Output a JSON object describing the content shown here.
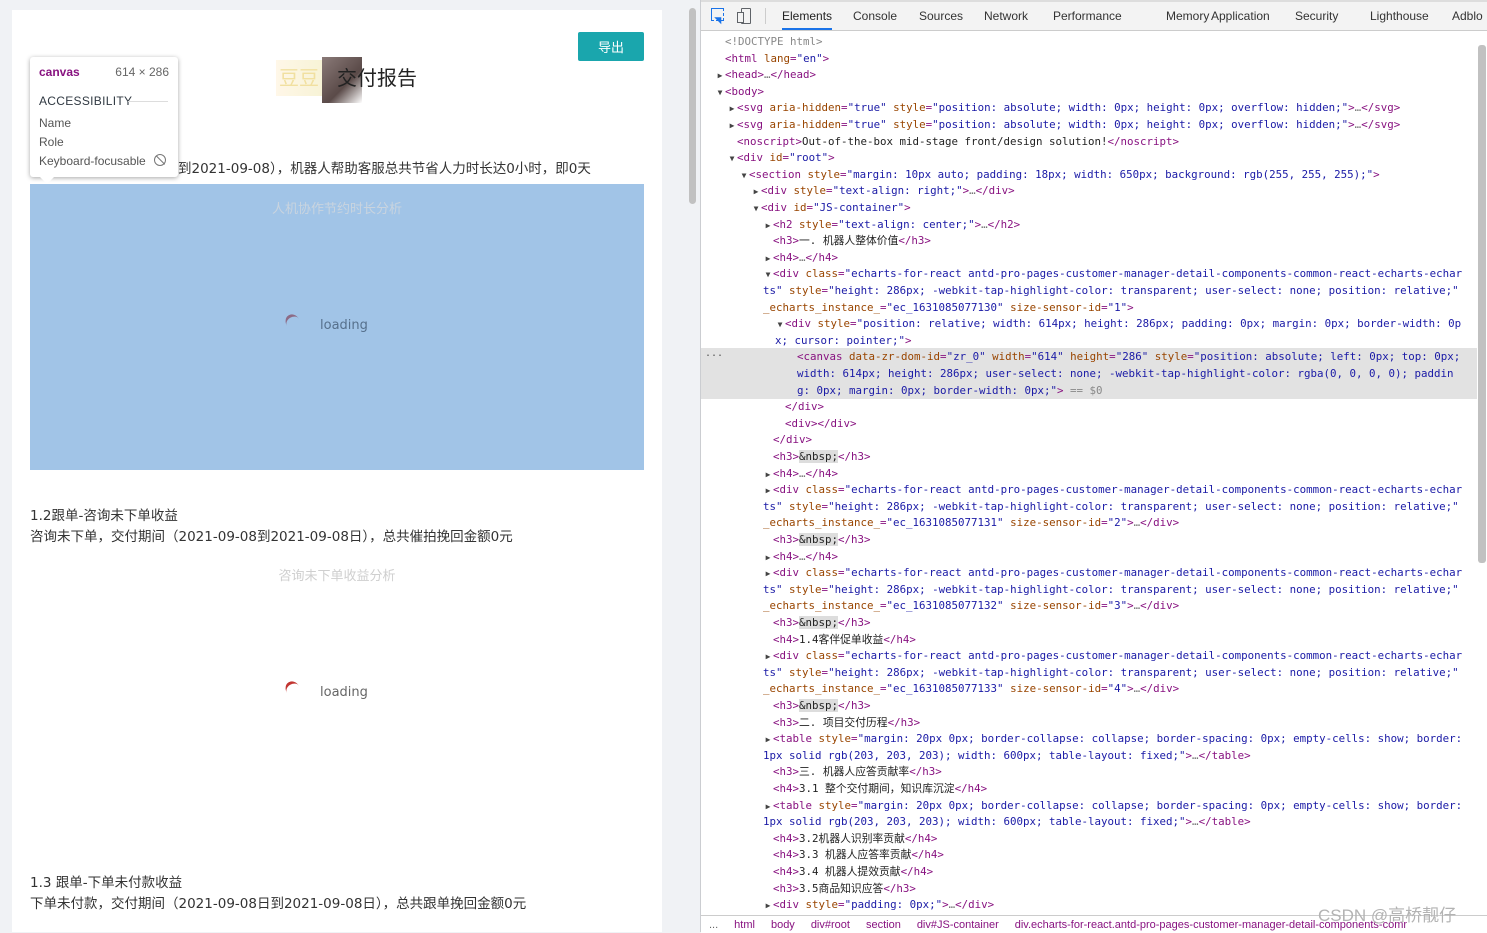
{
  "report": {
    "export_label": "导出",
    "title": "交付报告",
    "logo_text": "豆豆",
    "intro": "到2021-09-08），机器人帮助客服总共节省人力时长达0小时，即0天",
    "chart1": {
      "title": "人机协作节约时长分析",
      "loading": "loading"
    },
    "sec2_head": "1.2跟单-咨询未下单收益",
    "sec2_desc": "咨询未下单，交付期间（2021-09-08到2021-09-08日），总共催拍挽回金额0元",
    "chart2": {
      "title": "咨询未下单收益分析",
      "loading": "loading"
    },
    "sec3_head": "1.3 跟单-下单未付款收益",
    "sec3_desc": "下单未付款，交付期间（2021-09-08日到2021-09-08日），总共跟单挽回金额0元"
  },
  "tooltip": {
    "tag": "canvas",
    "size": "614 × 286",
    "accessibility": "ACCESSIBILITY",
    "name": "Name",
    "role": "Role",
    "focusable": "Keyboard-focusable"
  },
  "devtools": {
    "tabs": [
      "Elements",
      "Console",
      "Sources",
      "Network",
      "Performance",
      "Memory",
      "Application",
      "Security",
      "Lighthouse",
      "Adblo"
    ],
    "active_tab": "Elements",
    "breadcrumbs": [
      "...",
      "html",
      "body",
      "div#root",
      "section",
      "div#JS-container",
      "div.echarts-for-react.antd-pro-pages-customer-manager-detail-components-comr"
    ],
    "sel_marker": "...",
    "lines": [
      {
        "i": 0,
        "t": "",
        "h": "<span class=\"dim\">&lt;!DOCTYPE html&gt;</span>"
      },
      {
        "i": 0,
        "t": "",
        "h": "<span class=\"tn\">&lt;html</span> <span class=\"an\">lang</span><span class=\"tn\">=</span><span class=\"av\">\"en\"</span><span class=\"tn\">&gt;</span>"
      },
      {
        "i": 0,
        "t": "▶",
        "h": "<span class=\"tn\">&lt;head&gt;</span><span class=\"ell\">…</span><span class=\"tn\">&lt;/head&gt;</span>"
      },
      {
        "i": 0,
        "t": "▼",
        "h": "<span class=\"tn\">&lt;body&gt;</span>"
      },
      {
        "i": 1,
        "t": "▶",
        "h": "<span class=\"tn\">&lt;svg</span> <span class=\"an\">aria-hidden</span><span class=\"tn\">=</span><span class=\"av\">\"true\"</span> <span class=\"an\">style</span><span class=\"tn\">=</span><span class=\"av\">\"position: absolute; width: 0px; height: 0px; overflow: hidden;\"</span><span class=\"tn\">&gt;</span><span class=\"ell\">…</span><span class=\"tn\">&lt;/svg&gt;</span>"
      },
      {
        "i": 1,
        "t": "▶",
        "h": "<span class=\"tn\">&lt;svg</span> <span class=\"an\">aria-hidden</span><span class=\"tn\">=</span><span class=\"av\">\"true\"</span> <span class=\"an\">style</span><span class=\"tn\">=</span><span class=\"av\">\"position: absolute; width: 0px; height: 0px; overflow: hidden;\"</span><span class=\"tn\">&gt;</span><span class=\"ell\">…</span><span class=\"tn\">&lt;/svg&gt;</span>"
      },
      {
        "i": 1,
        "t": "",
        "h": "<span class=\"tn\">&lt;noscript&gt;</span><span class=\"tx\">Out-of-the-box mid-stage front/design solution!</span><span class=\"tn\">&lt;/noscript&gt;</span>"
      },
      {
        "i": 1,
        "t": "▼",
        "h": "<span class=\"tn\">&lt;div</span> <span class=\"an\">id</span><span class=\"tn\">=</span><span class=\"av\">\"root\"</span><span class=\"tn\">&gt;</span>"
      },
      {
        "i": 2,
        "t": "▼",
        "h": "<span class=\"tn\">&lt;section</span> <span class=\"an\">style</span><span class=\"tn\">=</span><span class=\"av\">\"margin: 10px auto; padding: 18px; width: 650px; background: rgb(255, 255, 255);\"</span><span class=\"tn\">&gt;</span>"
      },
      {
        "i": 3,
        "t": "▶",
        "h": "<span class=\"tn\">&lt;div</span> <span class=\"an\">style</span><span class=\"tn\">=</span><span class=\"av\">\"text-align: right;\"</span><span class=\"tn\">&gt;</span><span class=\"ell\">…</span><span class=\"tn\">&lt;/div&gt;</span>"
      },
      {
        "i": 3,
        "t": "▼",
        "h": "<span class=\"tn\">&lt;div</span> <span class=\"an\">id</span><span class=\"tn\">=</span><span class=\"av\">\"JS-container\"</span><span class=\"tn\">&gt;</span>"
      },
      {
        "i": 4,
        "t": "▶",
        "h": "<span class=\"tn\">&lt;h2</span> <span class=\"an\">style</span><span class=\"tn\">=</span><span class=\"av\">\"text-align: center;\"</span><span class=\"tn\">&gt;</span><span class=\"ell\">…</span><span class=\"tn\">&lt;/h2&gt;</span>"
      },
      {
        "i": 4,
        "t": "",
        "h": "<span class=\"tn\">&lt;h3&gt;</span><span class=\"tx\">一. 机器人整体价值</span><span class=\"tn\">&lt;/h3&gt;</span>"
      },
      {
        "i": 4,
        "t": "▶",
        "h": "<span class=\"tn\">&lt;h4&gt;</span><span class=\"ell\">…</span><span class=\"tn\">&lt;/h4&gt;</span>"
      },
      {
        "i": 4,
        "t": "▼",
        "h": "<span class=\"tn\">&lt;div</span> <span class=\"an\">class</span><span class=\"tn\">=</span><span class=\"av\">\"echarts-for-react antd-pro-pages-customer-manager-detail-components-common-react-echarts-echar</span>"
      },
      {
        "i": 4,
        "t": "",
        "x": -10,
        "h": "<span class=\"av\">ts\"</span> <span class=\"an\">style</span><span class=\"tn\">=</span><span class=\"av\">\"height: 286px; -webkit-tap-highlight-color: transparent; user-select: none; position: relative;\"</span>"
      },
      {
        "i": 4,
        "t": "",
        "x": -10,
        "h": "<span class=\"an\">_echarts_instance_</span><span class=\"tn\">=</span><span class=\"av\">\"ec_1631085077130\"</span> <span class=\"an\">size-sensor-id</span><span class=\"tn\">=</span><span class=\"av\">\"1\"</span><span class=\"tn\">&gt;</span>"
      },
      {
        "i": 5,
        "t": "▼",
        "h": "<span class=\"tn\">&lt;div</span> <span class=\"an\">style</span><span class=\"tn\">=</span><span class=\"av\">\"position: relative; width: 614px; height: 286px; padding: 0px; margin: 0px; border-width: 0p</span>"
      },
      {
        "i": 5,
        "t": "",
        "x": -10,
        "h": "<span class=\"av\">x; cursor: pointer;\"</span><span class=\"tn\">&gt;</span>"
      },
      {
        "i": 6,
        "t": "",
        "sel": true,
        "h": "<span class=\"tn\">&lt;canvas</span> <span class=\"an\">data-zr-dom-id</span><span class=\"tn\">=</span><span class=\"av\">\"zr_0\"</span> <span class=\"an\">width</span><span class=\"tn\">=</span><span class=\"av\">\"614\"</span> <span class=\"an\">height</span><span class=\"tn\">=</span><span class=\"av\">\"286\"</span> <span class=\"an\">style</span><span class=\"tn\">=</span><span class=\"av\">\"position: absolute; left: 0px; top: 0px;</span>"
      },
      {
        "i": 6,
        "t": "",
        "sel": true,
        "h": "<span class=\"av\">width: 614px; height: 286px; user-select: none; -webkit-tap-highlight-color: rgba(0, 0, 0, 0); paddin</span>"
      },
      {
        "i": 6,
        "t": "",
        "sel": true,
        "h": "<span class=\"av\">g: 0px; margin: 0px; border-width: 0px;\"</span><span class=\"tn\">&gt;</span> <span class=\"dim\">== $0</span>"
      },
      {
        "i": 5,
        "t": "",
        "h": "<span class=\"tn\">&lt;/div&gt;</span>"
      },
      {
        "i": 5,
        "t": "",
        "h": "<span class=\"tn\">&lt;div&gt;&lt;/div&gt;</span>"
      },
      {
        "i": 4,
        "t": "",
        "h": "<span class=\"tn\">&lt;/div&gt;</span>"
      },
      {
        "i": 4,
        "t": "",
        "h": "<span class=\"tn\">&lt;h3&gt;</span><span class=\"nbsp\">&amp;nbsp;</span><span class=\"tn\">&lt;/h3&gt;</span>"
      },
      {
        "i": 4,
        "t": "▶",
        "h": "<span class=\"tn\">&lt;h4&gt;</span><span class=\"ell\">…</span><span class=\"tn\">&lt;/h4&gt;</span>"
      },
      {
        "i": 4,
        "t": "▶",
        "h": "<span class=\"tn\">&lt;div</span> <span class=\"an\">class</span><span class=\"tn\">=</span><span class=\"av\">\"echarts-for-react antd-pro-pages-customer-manager-detail-components-common-react-echarts-echar</span>"
      },
      {
        "i": 4,
        "t": "",
        "x": -10,
        "h": "<span class=\"av\">ts\"</span> <span class=\"an\">style</span><span class=\"tn\">=</span><span class=\"av\">\"height: 286px; -webkit-tap-highlight-color: transparent; user-select: none; position: relative;\"</span>"
      },
      {
        "i": 4,
        "t": "",
        "x": -10,
        "h": "<span class=\"an\">_echarts_instance_</span><span class=\"tn\">=</span><span class=\"av\">\"ec_1631085077131\"</span> <span class=\"an\">size-sensor-id</span><span class=\"tn\">=</span><span class=\"av\">\"2\"</span><span class=\"tn\">&gt;</span><span class=\"ell\">…</span><span class=\"tn\">&lt;/div&gt;</span>"
      },
      {
        "i": 4,
        "t": "",
        "h": "<span class=\"tn\">&lt;h3&gt;</span><span class=\"nbsp\">&amp;nbsp;</span><span class=\"tn\">&lt;/h3&gt;</span>"
      },
      {
        "i": 4,
        "t": "▶",
        "h": "<span class=\"tn\">&lt;h4&gt;</span><span class=\"ell\">…</span><span class=\"tn\">&lt;/h4&gt;</span>"
      },
      {
        "i": 4,
        "t": "▶",
        "h": "<span class=\"tn\">&lt;div</span> <span class=\"an\">class</span><span class=\"tn\">=</span><span class=\"av\">\"echarts-for-react antd-pro-pages-customer-manager-detail-components-common-react-echarts-echar</span>"
      },
      {
        "i": 4,
        "t": "",
        "x": -10,
        "h": "<span class=\"av\">ts\"</span> <span class=\"an\">style</span><span class=\"tn\">=</span><span class=\"av\">\"height: 286px; -webkit-tap-highlight-color: transparent; user-select: none; position: relative;\"</span>"
      },
      {
        "i": 4,
        "t": "",
        "x": -10,
        "h": "<span class=\"an\">_echarts_instance_</span><span class=\"tn\">=</span><span class=\"av\">\"ec_1631085077132\"</span> <span class=\"an\">size-sensor-id</span><span class=\"tn\">=</span><span class=\"av\">\"3\"</span><span class=\"tn\">&gt;</span><span class=\"ell\">…</span><span class=\"tn\">&lt;/div&gt;</span>"
      },
      {
        "i": 4,
        "t": "",
        "h": "<span class=\"tn\">&lt;h3&gt;</span><span class=\"nbsp\">&amp;nbsp;</span><span class=\"tn\">&lt;/h3&gt;</span>"
      },
      {
        "i": 4,
        "t": "",
        "h": "<span class=\"tn\">&lt;h4&gt;</span><span class=\"tx\">1.4客伴促单收益</span><span class=\"tn\">&lt;/h4&gt;</span>"
      },
      {
        "i": 4,
        "t": "▶",
        "h": "<span class=\"tn\">&lt;div</span> <span class=\"an\">class</span><span class=\"tn\">=</span><span class=\"av\">\"echarts-for-react antd-pro-pages-customer-manager-detail-components-common-react-echarts-echar</span>"
      },
      {
        "i": 4,
        "t": "",
        "x": -10,
        "h": "<span class=\"av\">ts\"</span> <span class=\"an\">style</span><span class=\"tn\">=</span><span class=\"av\">\"height: 286px; -webkit-tap-highlight-color: transparent; user-select: none; position: relative;\"</span>"
      },
      {
        "i": 4,
        "t": "",
        "x": -10,
        "h": "<span class=\"an\">_echarts_instance_</span><span class=\"tn\">=</span><span class=\"av\">\"ec_1631085077133\"</span> <span class=\"an\">size-sensor-id</span><span class=\"tn\">=</span><span class=\"av\">\"4\"</span><span class=\"tn\">&gt;</span><span class=\"ell\">…</span><span class=\"tn\">&lt;/div&gt;</span>"
      },
      {
        "i": 4,
        "t": "",
        "h": "<span class=\"tn\">&lt;h3&gt;</span><span class=\"nbsp\">&amp;nbsp;</span><span class=\"tn\">&lt;/h3&gt;</span>"
      },
      {
        "i": 4,
        "t": "",
        "h": "<span class=\"tn\">&lt;h3&gt;</span><span class=\"tx\">二. 项目交付历程</span><span class=\"tn\">&lt;/h3&gt;</span>"
      },
      {
        "i": 4,
        "t": "▶",
        "h": "<span class=\"tn\">&lt;table</span> <span class=\"an\">style</span><span class=\"tn\">=</span><span class=\"av\">\"margin: 20px 0px; border-collapse: collapse; border-spacing: 0px; empty-cells: show; border:</span>"
      },
      {
        "i": 4,
        "t": "",
        "x": -10,
        "h": "<span class=\"av\">1px solid rgb(203, 203, 203); width: 600px; table-layout: fixed;\"</span><span class=\"tn\">&gt;</span><span class=\"ell\">…</span><span class=\"tn\">&lt;/table&gt;</span>"
      },
      {
        "i": 4,
        "t": "",
        "h": "<span class=\"tn\">&lt;h3&gt;</span><span class=\"tx\">三. 机器人应答贡献率</span><span class=\"tn\">&lt;/h3&gt;</span>"
      },
      {
        "i": 4,
        "t": "",
        "h": "<span class=\"tn\">&lt;h4&gt;</span><span class=\"tx\">3.1 整个交付期间，知识库沉淀</span><span class=\"tn\">&lt;/h4&gt;</span>"
      },
      {
        "i": 4,
        "t": "▶",
        "h": "<span class=\"tn\">&lt;table</span> <span class=\"an\">style</span><span class=\"tn\">=</span><span class=\"av\">\"margin: 20px 0px; border-collapse: collapse; border-spacing: 0px; empty-cells: show; border:</span>"
      },
      {
        "i": 4,
        "t": "",
        "x": -10,
        "h": "<span class=\"av\">1px solid rgb(203, 203, 203); width: 600px; table-layout: fixed;\"</span><span class=\"tn\">&gt;</span><span class=\"ell\">…</span><span class=\"tn\">&lt;/table&gt;</span>"
      },
      {
        "i": 4,
        "t": "",
        "h": "<span class=\"tn\">&lt;h4&gt;</span><span class=\"tx\">3.2机器人识别率贡献</span><span class=\"tn\">&lt;/h4&gt;</span>"
      },
      {
        "i": 4,
        "t": "",
        "h": "<span class=\"tn\">&lt;h4&gt;</span><span class=\"tx\">3.3 机器人应答率贡献</span><span class=\"tn\">&lt;/h4&gt;</span>"
      },
      {
        "i": 4,
        "t": "",
        "h": "<span class=\"tn\">&lt;h4&gt;</span><span class=\"tx\">3.4 机器人提效贡献</span><span class=\"tn\">&lt;/h4&gt;</span>"
      },
      {
        "i": 4,
        "t": "",
        "h": "<span class=\"tn\">&lt;h3&gt;</span><span class=\"tx\">3.5商品知识应答</span><span class=\"tn\">&lt;/h3&gt;</span>"
      },
      {
        "i": 4,
        "t": "▶",
        "h": "<span class=\"tn\">&lt;div</span> <span class=\"an\">style</span><span class=\"tn\">=</span><span class=\"av\">\"padding: 0px;\"</span><span class=\"tn\">&gt;</span><span class=\"ell\">…</span><span class=\"tn\">&lt;/div&gt;</span>"
      }
    ]
  },
  "watermark": "CSDN @高桥靓仔"
}
